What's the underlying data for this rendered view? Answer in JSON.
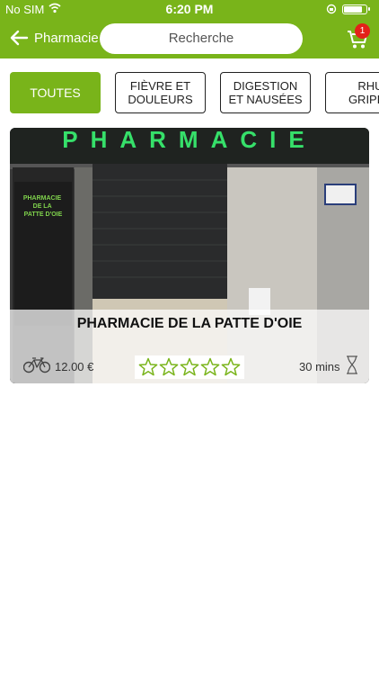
{
  "status_bar": {
    "carrier": "No SIM",
    "time": "6:20 PM"
  },
  "header": {
    "title": "Pharmacie",
    "search_placeholder": "Recherche",
    "cart_count": "1"
  },
  "categories": [
    {
      "label": "TOUTES",
      "active": true
    },
    {
      "label": "FIÈVRE ET\nDOULEURS",
      "active": false
    },
    {
      "label": "DIGESTION\nET NAUSÉES",
      "active": false
    },
    {
      "label": "RHU\nGRIPPE",
      "active": false
    }
  ],
  "card": {
    "name": "PHARMACIE DE LA PATTE D'OIE",
    "delivery_price": "12.00 €",
    "rating": 0,
    "rating_max": 5,
    "delivery_time": "30 mins",
    "sign_text": "PHARMACIE",
    "poster_title": "PHARMACIE\nDE LA\nPATTE D'OIE"
  },
  "colors": {
    "brand": "#79b41a",
    "badge": "#e32219"
  }
}
